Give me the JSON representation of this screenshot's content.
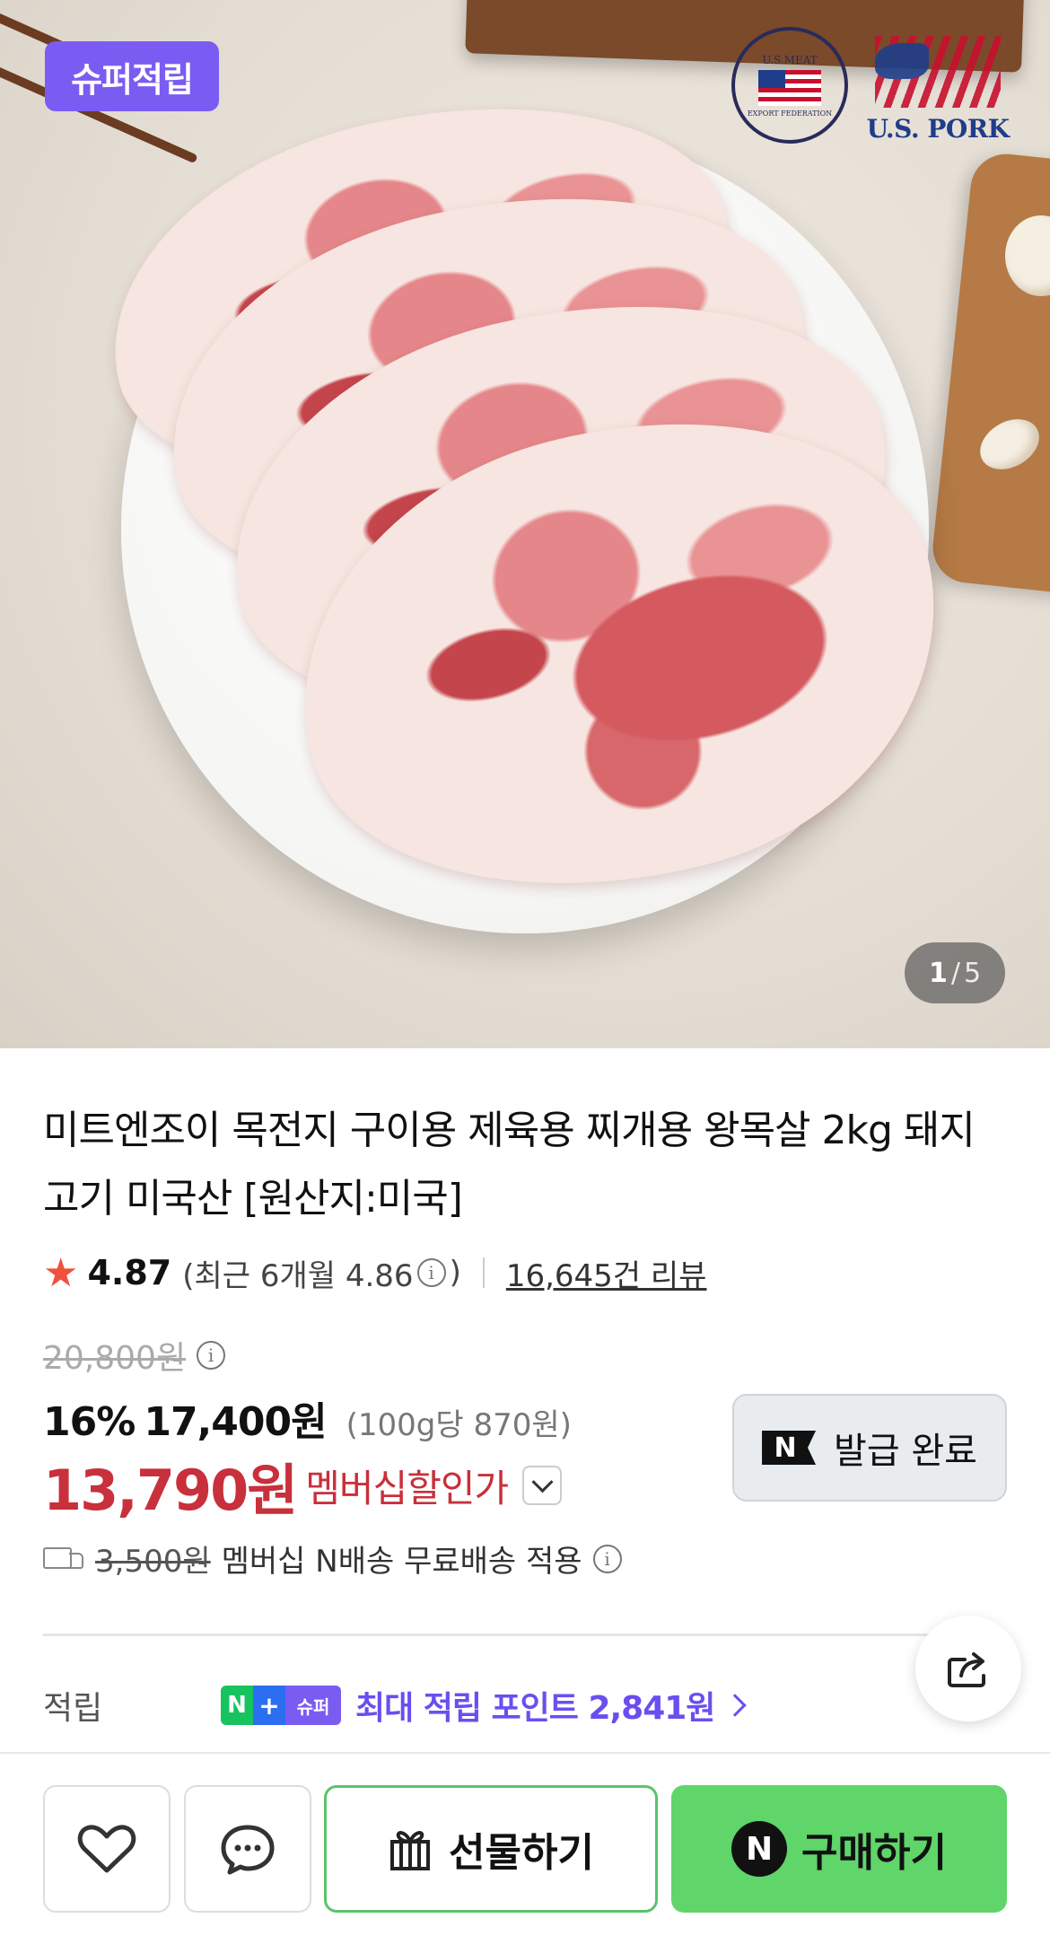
{
  "hero": {
    "badge": "슈퍼적립",
    "seal_text": "U.S.MEAT",
    "seal_sub": "EXPORT FEDERATION",
    "brand_logo": "U.S. PORK",
    "counter_current": "1",
    "counter_sep": "/",
    "counter_total": "5"
  },
  "product": {
    "title": "미트엔조이 목전지 구이용 제육용 찌개용 왕목살 2kg 돼지고기 미국산 [원산지:미국]",
    "rating": "4.87",
    "recent_rating": "(최근 6개월 4.86",
    "recent_close": ")",
    "review_count": "16,645건 리뷰"
  },
  "price": {
    "original": "20,800원",
    "discount_pct": "16%",
    "sale": "17,400원",
    "unit_price": "(100g당 870원)",
    "member_price": "13,790원",
    "member_label": "멤버십할인가",
    "coupon_label": "발급 완료",
    "coupon_icon": "N"
  },
  "delivery": {
    "old_fee": "3,500원",
    "text": "멤버십 N배송 무료배송 적용"
  },
  "points": {
    "label": "적립",
    "badge_n": "N",
    "badge_plus": "+",
    "badge_super": "슈퍼",
    "text": "최대 적립 포인트 2,841원"
  },
  "bottom": {
    "gift_label": "선물하기",
    "buy_icon": "N",
    "buy_label": "구매하기"
  },
  "colors": {
    "accent_purple": "#7a5cf2",
    "sale_red": "#c8303b",
    "buy_green": "#5fd56a",
    "star": "#f0503c"
  }
}
